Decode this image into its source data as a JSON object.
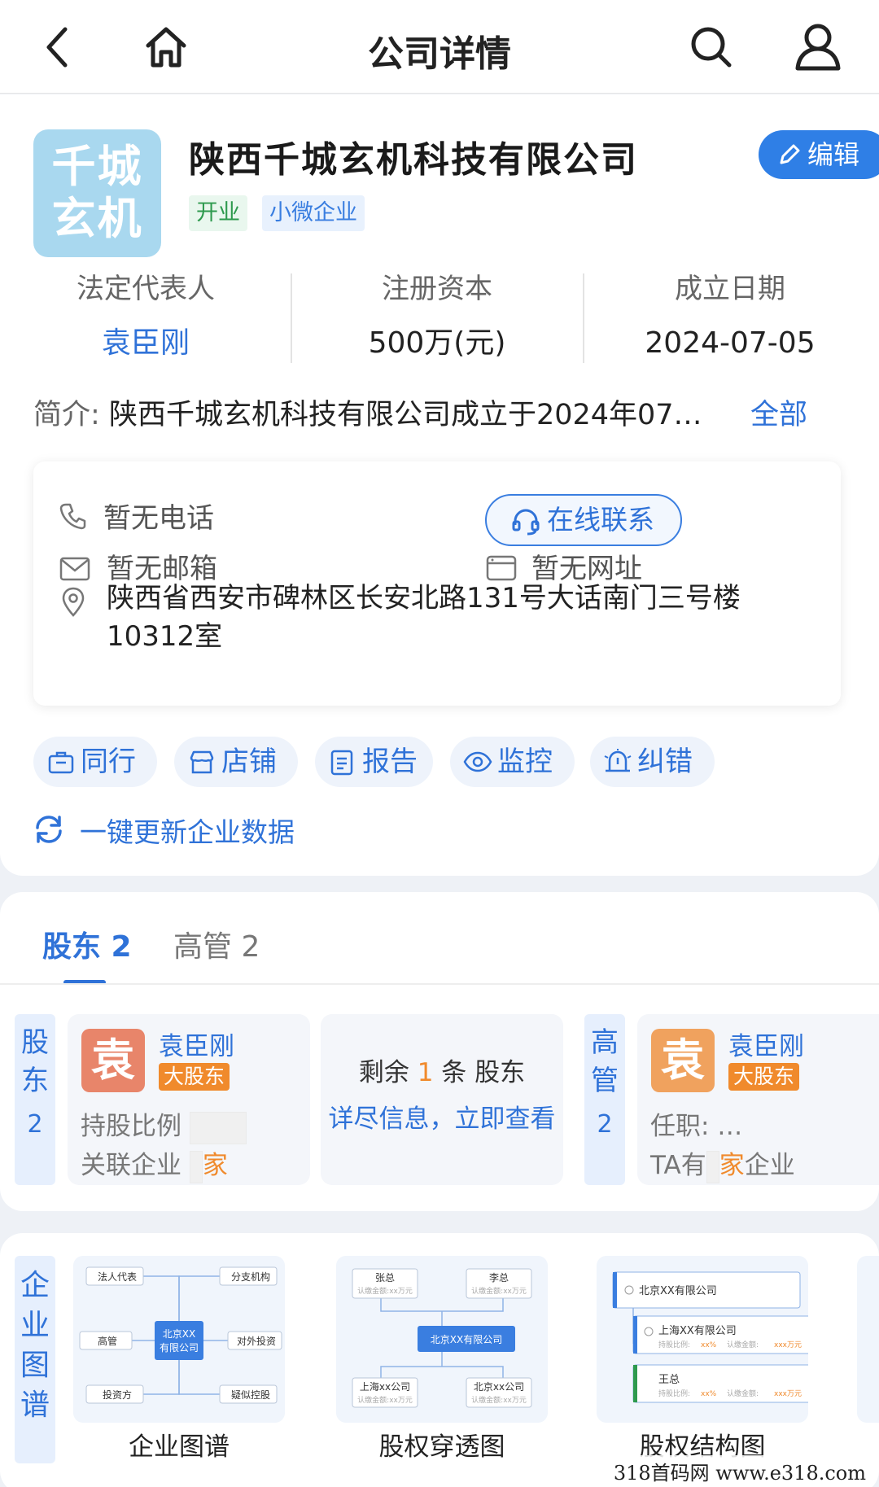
{
  "header": {
    "title": "公司详情"
  },
  "company": {
    "logo_line1": "千城",
    "logo_line2": "玄机",
    "name": "陕西千城玄机科技有限公司",
    "tags": [
      "开业",
      "小微企业"
    ],
    "edit_label": "编辑"
  },
  "stats": [
    {
      "label": "法定代表人",
      "value": "袁臣刚"
    },
    {
      "label": "注册资本",
      "value": "500万(元)"
    },
    {
      "label": "成立日期",
      "value": "2024-07-05"
    }
  ],
  "intro": {
    "key": "简介:",
    "text": "陕西千城玄机科技有限公司成立于2024年07…",
    "more": "全部"
  },
  "contact": {
    "phone": "暂无电话",
    "email": "暂无邮箱",
    "online": "在线联系",
    "website": "暂无网址",
    "address": "陕西省西安市碑林区长安北路131号大话南门三号楼10312室"
  },
  "actions": [
    "同行",
    "店铺",
    "报告",
    "监控",
    "纠错"
  ],
  "update_label": "一键更新企业数据",
  "tabs": {
    "shareholders": "股东 2",
    "executives": "高管 2"
  },
  "shareholder_section": {
    "vlabel_chars": [
      "股",
      "东"
    ],
    "count": "2",
    "person": {
      "avatar": "袁",
      "name": "袁臣刚",
      "badge": "大股东",
      "ratio_label": "持股比例",
      "related_label": "关联企业",
      "related_suffix": "家"
    },
    "remaining_prefix": "剩余",
    "remaining_num": "1",
    "remaining_suffix": "条 股东",
    "detail_link": "详尽信息，立即查看"
  },
  "executive_section": {
    "vlabel_chars": [
      "高",
      "管"
    ],
    "count": "2",
    "person": {
      "avatar": "袁",
      "name": "袁臣刚",
      "badge": "大股东",
      "role_label": "任职: …",
      "ta_prefix": "TA有",
      "ta_mid": "家",
      "ta_suffix": "企业"
    }
  },
  "graph_section": {
    "vlabel_chars": [
      "企",
      "业",
      "图",
      "谱"
    ],
    "thumbs": [
      {
        "label": "企业图谱",
        "center": [
          "北京XX",
          "有限公司"
        ],
        "nodes": [
          "法人代表",
          "分支机构",
          "高管",
          "对外投资",
          "投资方",
          "疑似控股"
        ]
      },
      {
        "label": "股权穿透图",
        "center": "北京XX有限公司",
        "top": [
          "张总",
          "李总"
        ],
        "bottom": [
          "上海xx公司",
          "北京xx公司"
        ],
        "sub": "认缴金额:xx万元"
      },
      {
        "label": "股权结构图",
        "root": "北京XX有限公司",
        "child1": "上海XX有限公司",
        "child2": "王总",
        "sub1": "持股比例:",
        "sub2": "xx%",
        "sub3": "认缴金额:",
        "sub4": "xxx万元"
      }
    ]
  },
  "watermark": "318首码网  www.e318.com",
  "colors": {
    "accent": "#2f72d8",
    "badge": "#f08a2c",
    "logo_bg": "#a9d8ef"
  }
}
